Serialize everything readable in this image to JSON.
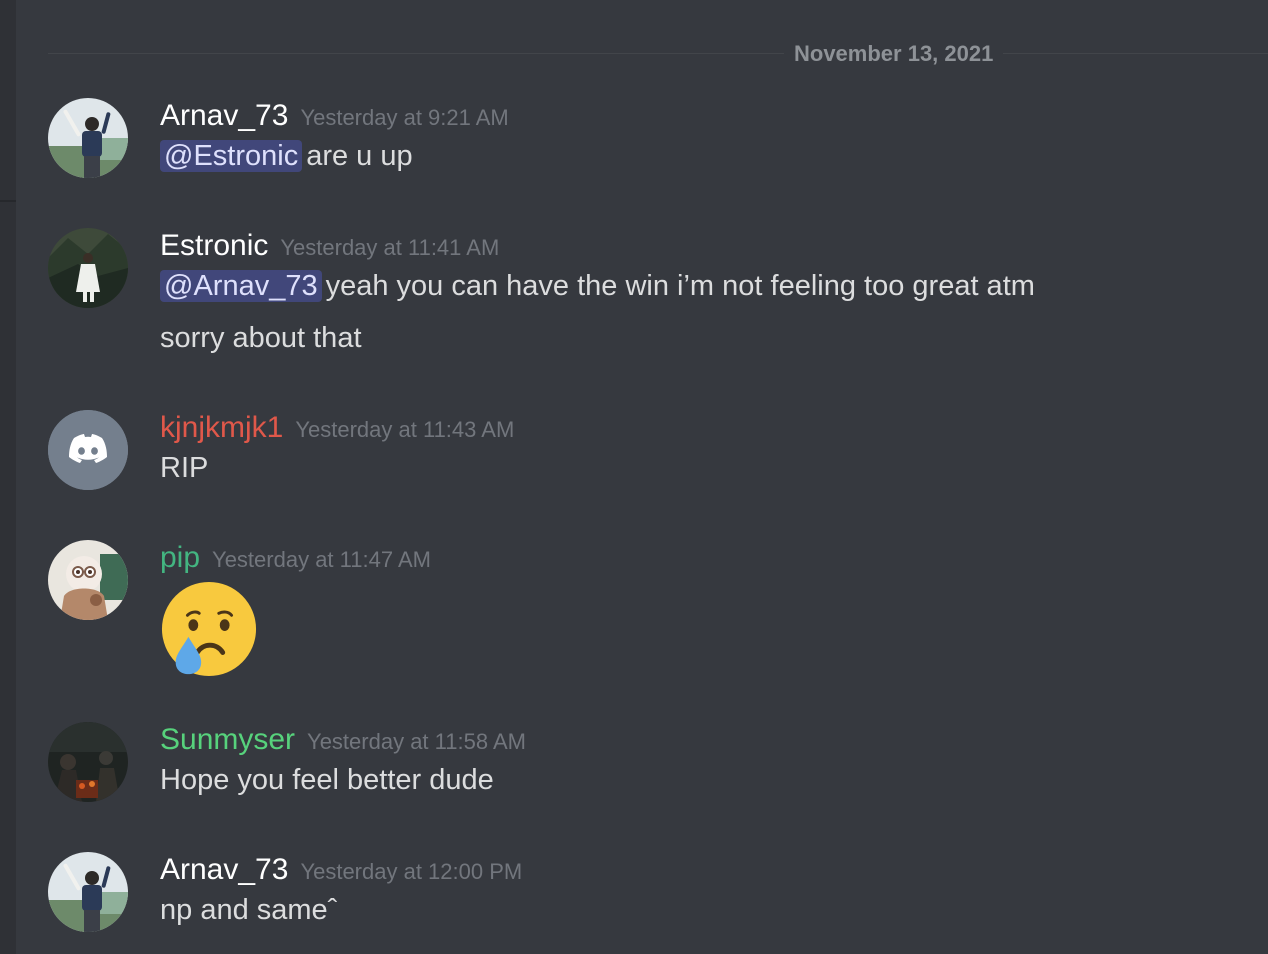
{
  "date_divider": "November 13, 2021",
  "colors": {
    "background": "#36393f",
    "username_default": "#ffffff",
    "username_kjnjkmjk1": "#e0584a",
    "username_pip": "#43b581",
    "username_sunmyser": "#57d27c",
    "timestamp": "#72767d",
    "mention_bg": "#414675"
  },
  "messages": [
    {
      "author": "Arnav_73",
      "timestamp": "Yesterday at 9:21 AM",
      "mention": "@Estronic",
      "text": "are u up",
      "avatar": "photo-avatar"
    },
    {
      "author": "Estronic",
      "timestamp": "Yesterday at 11:41 AM",
      "mention": "@Arnav_73",
      "text": "yeah you can have the win i’m not feeling too great atm",
      "text2": "sorry about that",
      "avatar": "photo-avatar"
    },
    {
      "author": "kjnjkmjk1",
      "timestamp": "Yesterday at 11:43 AM",
      "text": "RIP",
      "avatar": "discord-default-icon"
    },
    {
      "author": "pip",
      "timestamp": "Yesterday at 11:47 AM",
      "emoji": "crying-face-emoji",
      "avatar": "photo-avatar"
    },
    {
      "author": "Sunmyser",
      "timestamp": "Yesterday at 11:58 AM",
      "text": "Hope you feel better dude",
      "avatar": "photo-avatar"
    },
    {
      "author": "Arnav_73",
      "timestamp": "Yesterday at 12:00 PM",
      "text": "np and sameˆ",
      "avatar": "photo-avatar"
    }
  ]
}
